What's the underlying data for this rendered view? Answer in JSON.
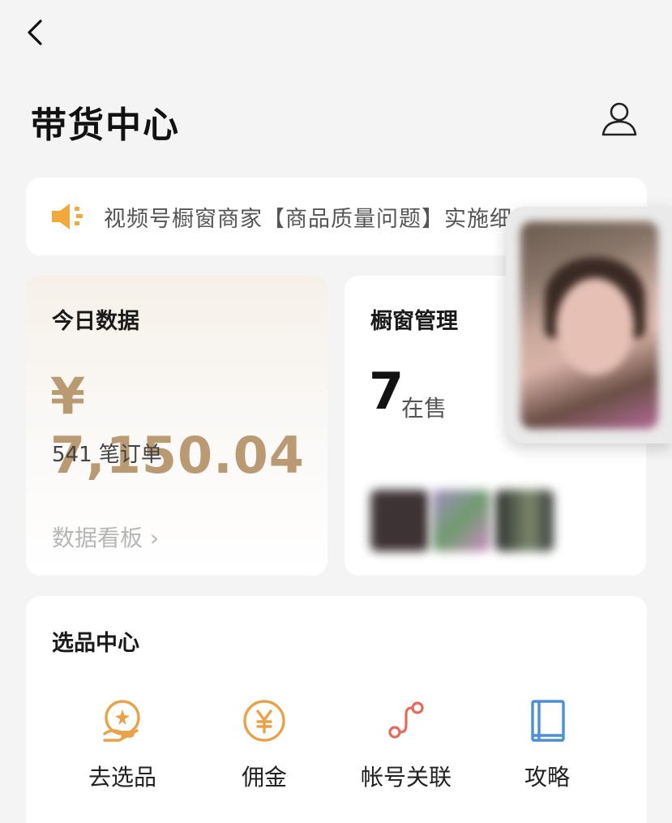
{
  "header": {
    "title": "带货中心"
  },
  "notice": {
    "text": "视频号橱窗商家【商品质量问题】实施细"
  },
  "today": {
    "label": "今日数据",
    "amount": "¥ 7,150.04",
    "orders": "541 笔订单",
    "dashboard_link": "数据看板 ›"
  },
  "window": {
    "label": "橱窗管理",
    "count": "7",
    "count_label": "在售"
  },
  "select_center": {
    "label": "选品中心",
    "tools": [
      {
        "label": "去选品",
        "icon": "hand-star-icon",
        "color": "#e8a248"
      },
      {
        "label": "佣金",
        "icon": "yen-circle-icon",
        "color": "#e8a248"
      },
      {
        "label": "帐号关联",
        "icon": "link-nodes-icon",
        "color": "#e66a5a"
      },
      {
        "label": "攻略",
        "icon": "book-icon",
        "color": "#4a8fd8"
      }
    ]
  },
  "colors": {
    "amount": "#b99a72",
    "background": "#f4f4f4",
    "notice_icon": "#f2a93b"
  }
}
